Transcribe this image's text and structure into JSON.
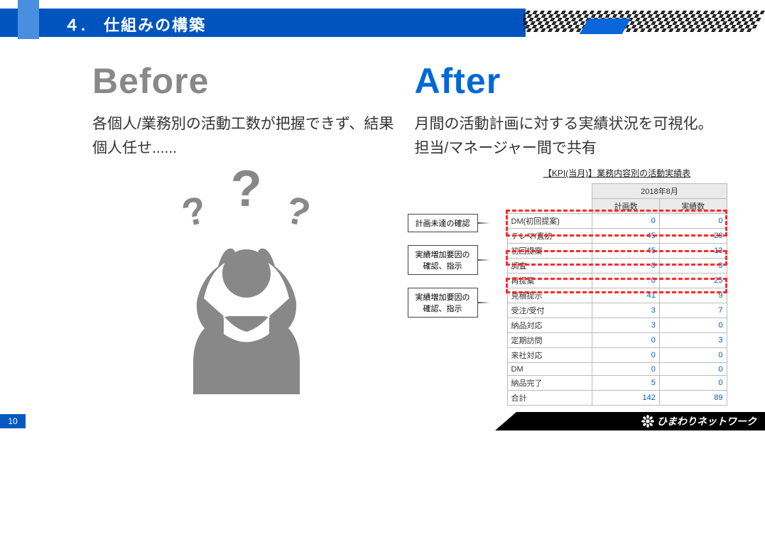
{
  "header": {
    "title": "４.　仕組みの構築"
  },
  "before": {
    "heading": "Before",
    "desc": "各個人/業務別の活動工数が把握できず、結果個人任せ......"
  },
  "after": {
    "heading": "After",
    "desc": "月間の活動計画に対する実績状況を可視化。担当/マネージャー間で共有"
  },
  "callouts": [
    "計画未達の確認",
    "実績増加要因の\n確認、指示",
    "実績増加要因の\n確認、指示"
  ],
  "table": {
    "caption": "【KPI(当月)】業務内容別の活動実績表",
    "period": "2018年8月",
    "head_plan": "計画数",
    "head_actual": "実績数",
    "rows": [
      {
        "label": "DM(初回提案)",
        "plan": "0",
        "actual": "0"
      },
      {
        "label": "テレマ/直訪",
        "plan": "45",
        "actual": "29"
      },
      {
        "label": "初回提案",
        "plan": "45",
        "actual": "13"
      },
      {
        "label": "調査",
        "plan": "0",
        "actual": "3"
      },
      {
        "label": "再提案",
        "plan": "0",
        "actual": "25"
      },
      {
        "label": "見積提示",
        "plan": "41",
        "actual": "9"
      },
      {
        "label": "受注/受付",
        "plan": "3",
        "actual": "7"
      },
      {
        "label": "納品対応",
        "plan": "3",
        "actual": "0"
      },
      {
        "label": "定期訪問",
        "plan": "0",
        "actual": "3"
      },
      {
        "label": "来社対応",
        "plan": "0",
        "actual": "0"
      },
      {
        "label": "DM",
        "plan": "0",
        "actual": "0"
      },
      {
        "label": "納品完了",
        "plan": "5",
        "actual": "0"
      },
      {
        "label": "合計",
        "plan": "142",
        "actual": "89"
      }
    ]
  },
  "footer": {
    "page": "10",
    "brand": "ひまわりネットワーク"
  }
}
